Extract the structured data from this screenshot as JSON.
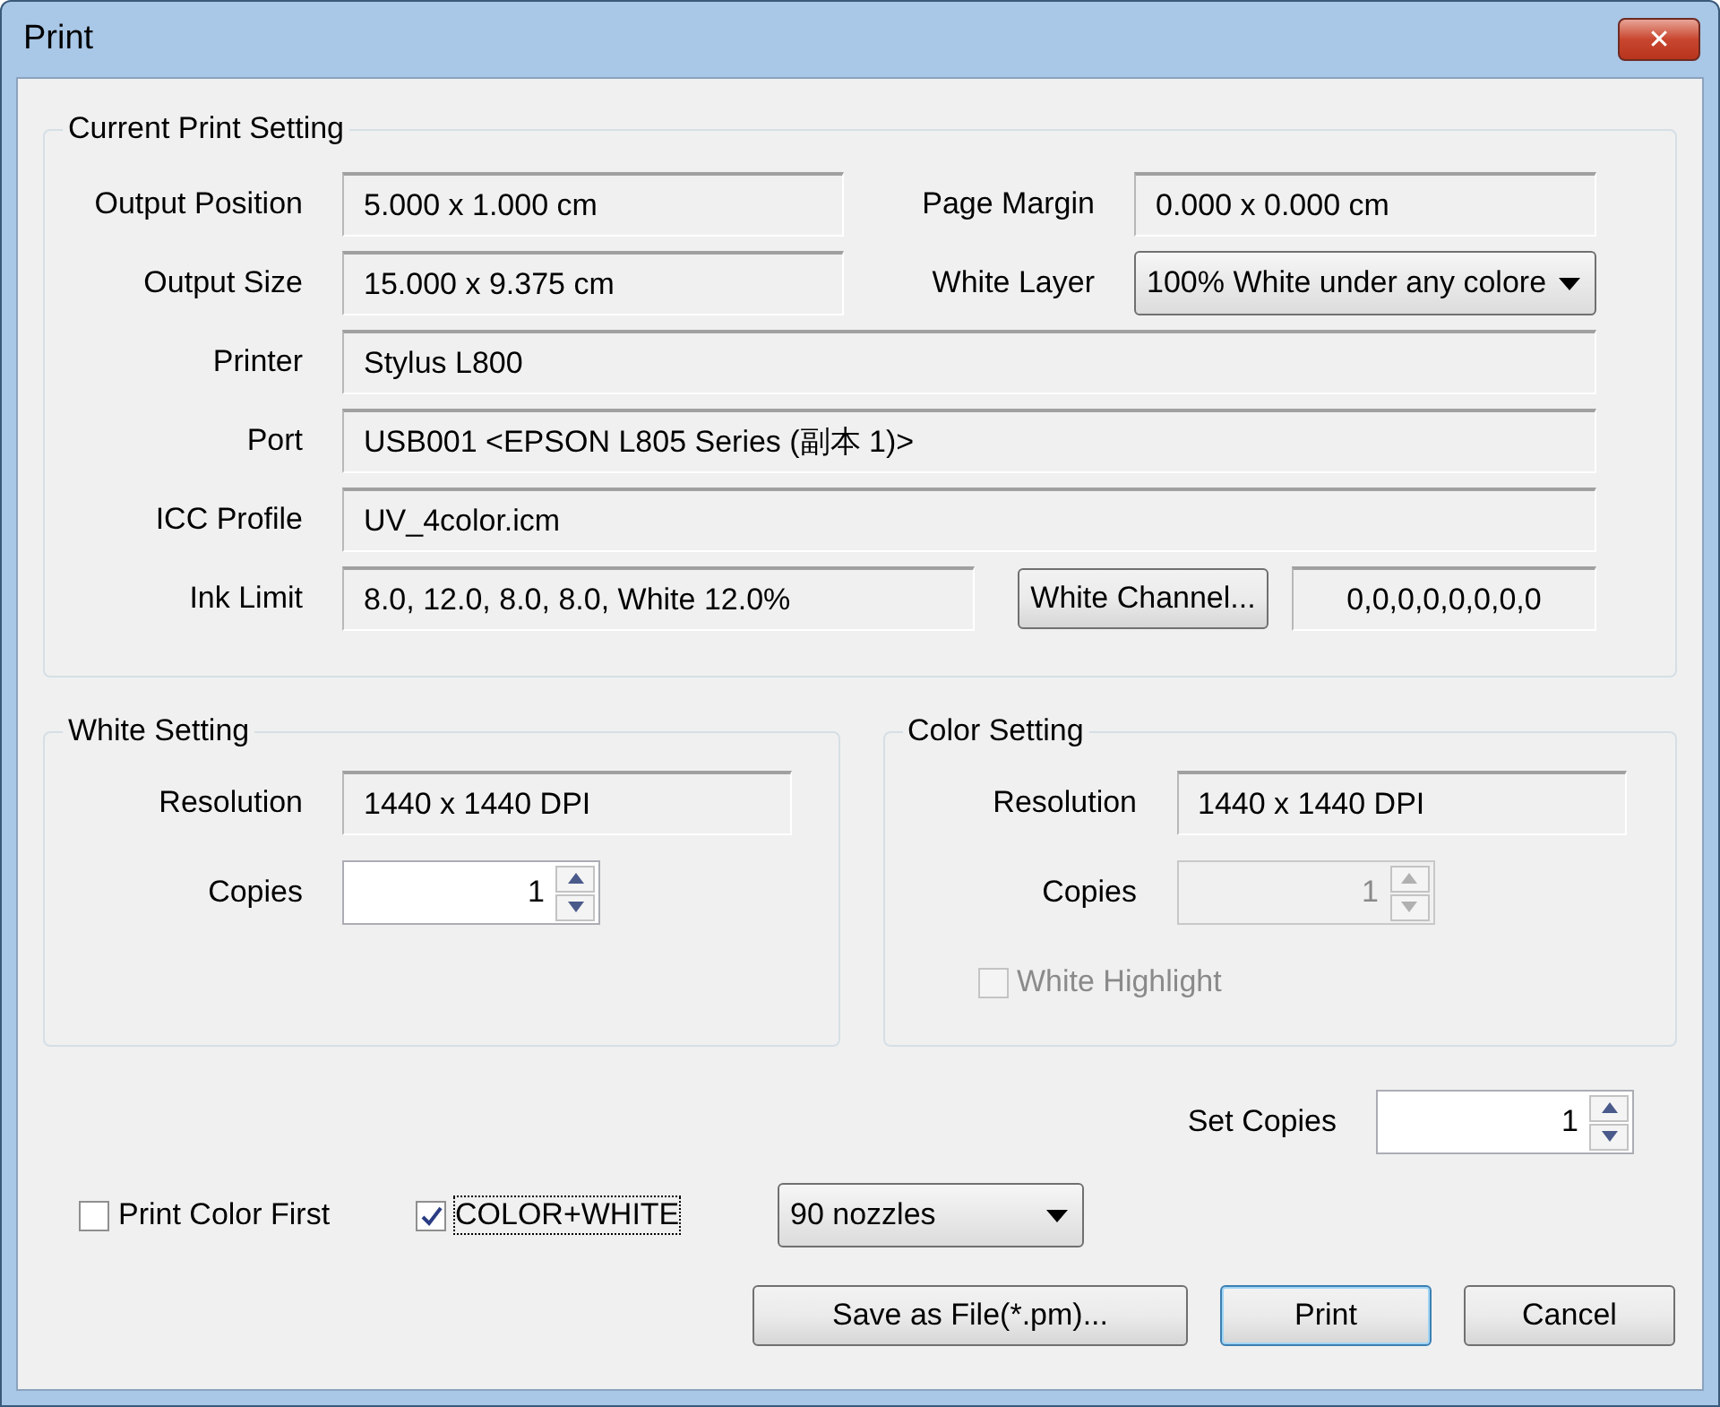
{
  "window": {
    "title": "Print",
    "close": "✕"
  },
  "current": {
    "title": "Current Print Setting",
    "output_position": {
      "label": "Output Position",
      "value": "5.000 x 1.000 cm"
    },
    "page_margin": {
      "label": "Page Margin",
      "value": "0.000 x 0.000 cm"
    },
    "output_size": {
      "label": "Output Size",
      "value": "15.000 x 9.375 cm"
    },
    "white_layer": {
      "label": "White Layer",
      "value": "100% White under any colore"
    },
    "printer": {
      "label": "Printer",
      "value": "Stylus L800"
    },
    "port": {
      "label": "Port",
      "value": "USB001  <EPSON L805 Series (副本 1)>"
    },
    "icc_profile": {
      "label": "ICC Profile",
      "value": "UV_4color.icm"
    },
    "ink_limit": {
      "label": "Ink Limit",
      "value": "8.0, 12.0, 8.0, 8.0, White 12.0%"
    },
    "white_channel_button": "White Channel...",
    "white_channel_value": "0,0,0,0,0,0,0,0"
  },
  "white_setting": {
    "title": "White Setting",
    "resolution": {
      "label": "Resolution",
      "value": "1440 x 1440 DPI"
    },
    "copies": {
      "label": "Copies",
      "value": "1",
      "disabled": false
    }
  },
  "color_setting": {
    "title": "Color Setting",
    "resolution": {
      "label": "Resolution",
      "value": "1440 x 1440 DPI"
    },
    "copies": {
      "label": "Copies",
      "value": "1",
      "disabled": true
    },
    "white_highlight": {
      "label": "White Highlight",
      "checked": false,
      "disabled": true
    }
  },
  "set_copies": {
    "label": "Set Copies",
    "value": "1",
    "disabled": false
  },
  "options": [
    {
      "label": "Print Color First",
      "checked": false,
      "disabled": false,
      "focused": false
    },
    {
      "label": "COLOR+WHITE",
      "checked": true,
      "disabled": false,
      "focused": true
    }
  ],
  "nozzles": {
    "value": "90 nozzles"
  },
  "buttons": [
    {
      "label": "Save as File(*.pm)...",
      "default": false
    },
    {
      "label": "Print",
      "default": true
    },
    {
      "label": "Cancel",
      "default": false
    }
  ]
}
